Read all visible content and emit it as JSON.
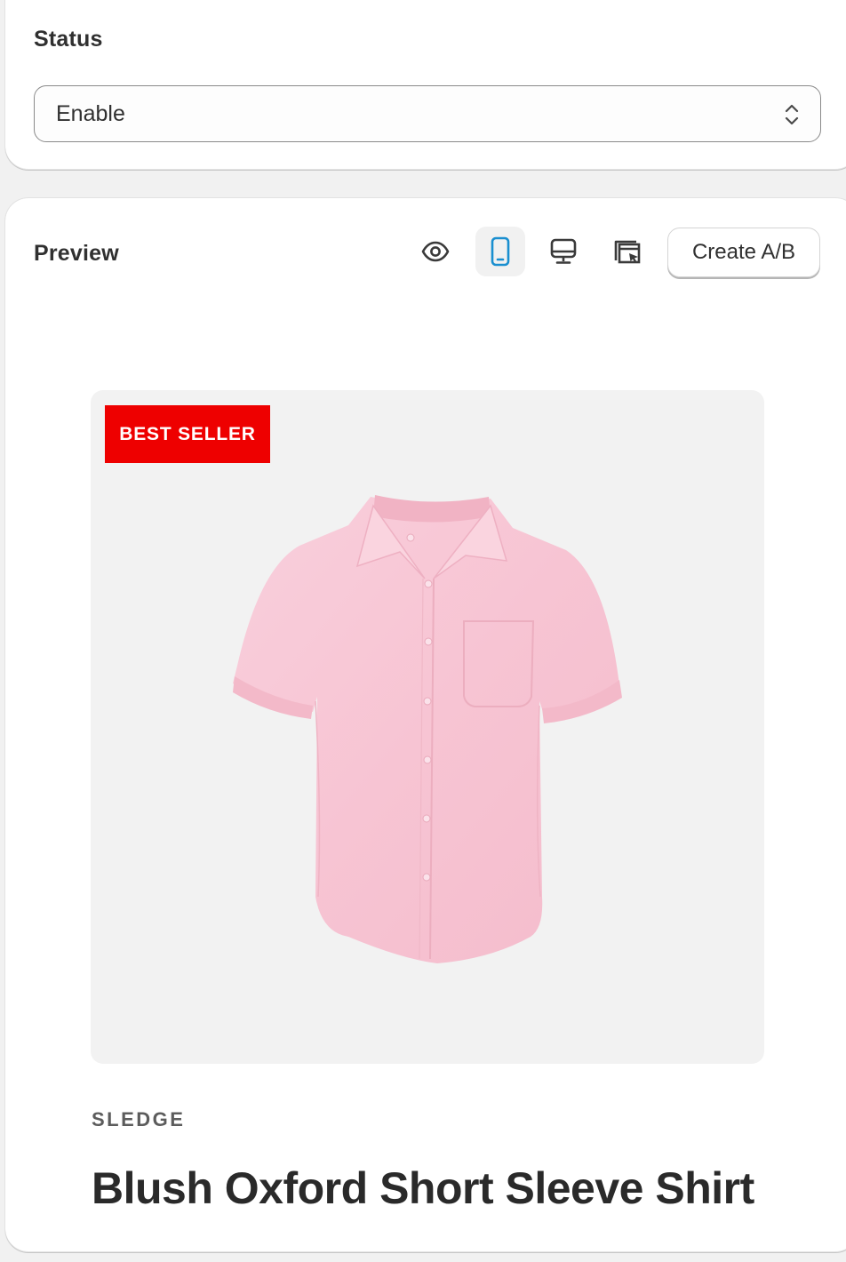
{
  "status": {
    "title": "Status",
    "select_value": "Enable"
  },
  "preview": {
    "title": "Preview",
    "toolbar": {
      "view_icon": "eye-icon",
      "mobile_icon": "mobile-icon",
      "desktop_icon": "desktop-icon",
      "window_icon": "browser-window-icon",
      "create_ab_label": "Create A/B",
      "active_view": "mobile"
    },
    "product": {
      "badge": "BEST SELLER",
      "badge_color": "#ee0000",
      "vendor": "SLEDGE",
      "title": "Blush Oxford Short Sleeve Shirt"
    }
  }
}
